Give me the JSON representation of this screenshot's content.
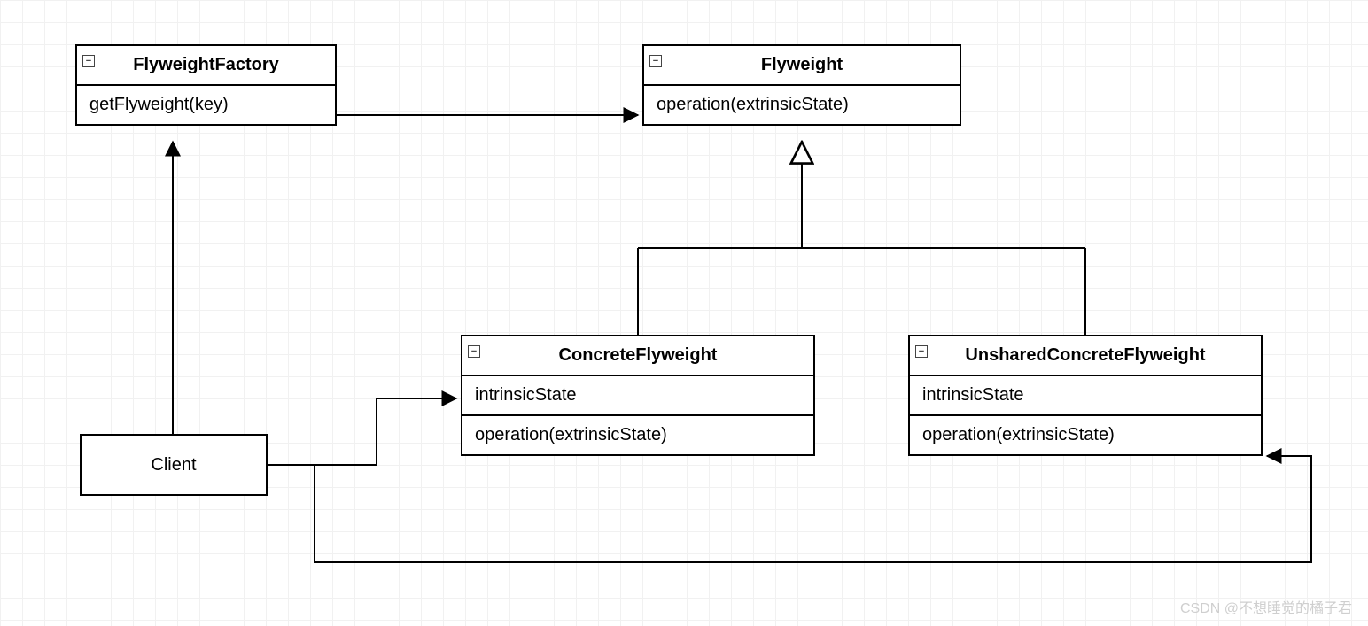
{
  "classes": {
    "flyweightFactory": {
      "name": "FlyweightFactory",
      "methods": [
        "getFlyweight(key)"
      ]
    },
    "flyweight": {
      "name": "Flyweight",
      "methods": [
        "operation(extrinsicState)"
      ]
    },
    "concreteFlyweight": {
      "name": "ConcreteFlyweight",
      "attributes": [
        "intrinsicState"
      ],
      "methods": [
        "operation(extrinsicState)"
      ]
    },
    "unsharedConcreteFlyweight": {
      "name": "UnsharedConcreteFlyweight",
      "attributes": [
        "intrinsicState"
      ],
      "methods": [
        "operation(extrinsicState)"
      ]
    },
    "client": {
      "name": "Client"
    }
  },
  "relations": [
    {
      "from": "FlyweightFactory",
      "to": "Flyweight",
      "type": "association"
    },
    {
      "from": "Client",
      "to": "FlyweightFactory",
      "type": "association"
    },
    {
      "from": "Client",
      "to": "ConcreteFlyweight",
      "type": "association"
    },
    {
      "from": "Client",
      "to": "UnsharedConcreteFlyweight",
      "type": "association"
    },
    {
      "from": "ConcreteFlyweight",
      "to": "Flyweight",
      "type": "generalization"
    },
    {
      "from": "UnsharedConcreteFlyweight",
      "to": "Flyweight",
      "type": "generalization"
    }
  ],
  "watermark": "CSDN @不想睡觉的橘子君"
}
